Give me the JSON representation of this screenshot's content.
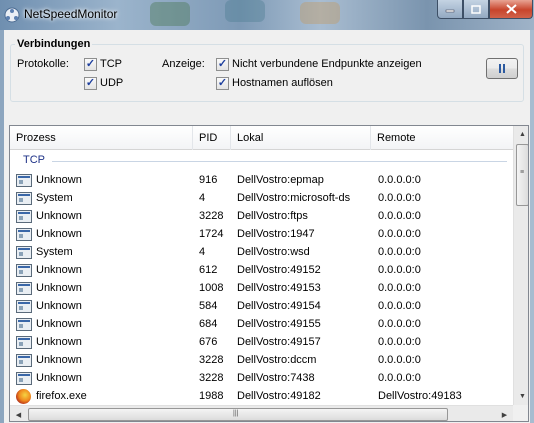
{
  "window": {
    "title": "NetSpeedMonitor"
  },
  "connections": {
    "title": "Verbindungen",
    "protocols_label": "Protokolle:",
    "display_label": "Anzeige:",
    "options": {
      "tcp": {
        "label": "TCP",
        "checked": true
      },
      "udp": {
        "label": "UDP",
        "checked": true
      },
      "show_unconnected": {
        "label": "Nicht verbundene Endpunkte anzeigen",
        "checked": true
      },
      "resolve_hostnames": {
        "label": "Hostnamen auflösen",
        "checked": true
      }
    },
    "pause_icon": "pause-icon"
  },
  "table": {
    "columns": [
      "Prozess",
      "PID",
      "Lokal",
      "Remote"
    ],
    "group": "TCP",
    "rows": [
      {
        "icon": "window-icon",
        "process": "Unknown",
        "pid": "916",
        "local": "DellVostro:epmap",
        "remote": "0.0.0.0:0"
      },
      {
        "icon": "window-icon",
        "process": "System",
        "pid": "4",
        "local": "DellVostro:microsoft-ds",
        "remote": "0.0.0.0:0"
      },
      {
        "icon": "window-icon",
        "process": "Unknown",
        "pid": "3228",
        "local": "DellVostro:ftps",
        "remote": "0.0.0.0:0"
      },
      {
        "icon": "window-icon",
        "process": "Unknown",
        "pid": "1724",
        "local": "DellVostro:1947",
        "remote": "0.0.0.0:0"
      },
      {
        "icon": "window-icon",
        "process": "System",
        "pid": "4",
        "local": "DellVostro:wsd",
        "remote": "0.0.0.0:0"
      },
      {
        "icon": "window-icon",
        "process": "Unknown",
        "pid": "612",
        "local": "DellVostro:49152",
        "remote": "0.0.0.0:0"
      },
      {
        "icon": "window-icon",
        "process": "Unknown",
        "pid": "1008",
        "local": "DellVostro:49153",
        "remote": "0.0.0.0:0"
      },
      {
        "icon": "window-icon",
        "process": "Unknown",
        "pid": "584",
        "local": "DellVostro:49154",
        "remote": "0.0.0.0:0"
      },
      {
        "icon": "window-icon",
        "process": "Unknown",
        "pid": "684",
        "local": "DellVostro:49155",
        "remote": "0.0.0.0:0"
      },
      {
        "icon": "window-icon",
        "process": "Unknown",
        "pid": "676",
        "local": "DellVostro:49157",
        "remote": "0.0.0.0:0"
      },
      {
        "icon": "window-icon",
        "process": "Unknown",
        "pid": "3228",
        "local": "DellVostro:dccm",
        "remote": "0.0.0.0:0"
      },
      {
        "icon": "window-icon",
        "process": "Unknown",
        "pid": "3228",
        "local": "DellVostro:7438",
        "remote": "0.0.0.0:0"
      },
      {
        "icon": "firefox-icon",
        "process": "firefox.exe",
        "pid": "1988",
        "local": "DellVostro:49182",
        "remote": "DellVostro:49183"
      }
    ]
  }
}
